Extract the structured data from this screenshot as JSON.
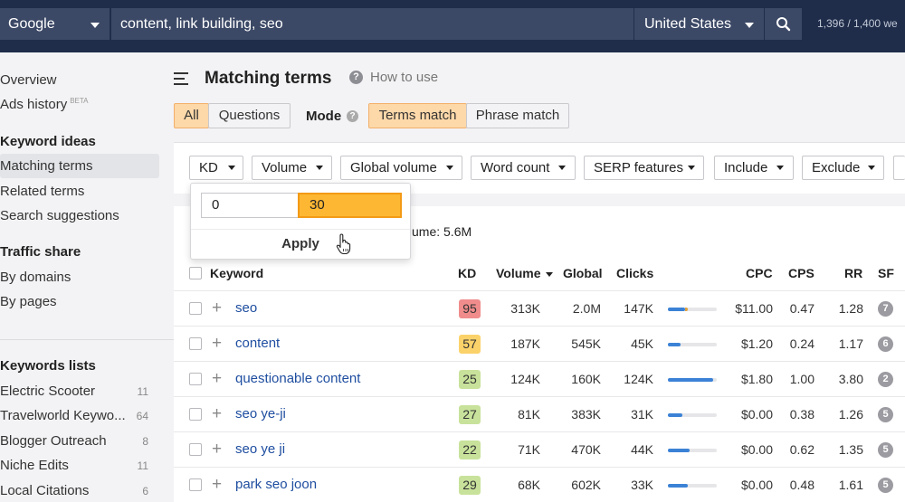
{
  "topbar": {
    "engine": "Google",
    "query": "content, link building, seo",
    "country": "United States",
    "quota": "1,396 / 1,400 we"
  },
  "sidebar": {
    "nav": [
      {
        "label": "Overview"
      },
      {
        "label": "Ads history",
        "badge": "BETA"
      }
    ],
    "keyword_ideas": {
      "heading": "Keyword ideas",
      "items": [
        "Matching terms",
        "Related terms",
        "Search suggestions"
      ]
    },
    "traffic_share": {
      "heading": "Traffic share",
      "items": [
        "By domains",
        "By pages"
      ]
    },
    "keyword_lists": {
      "heading": "Keywords lists",
      "items": [
        {
          "label": "Electric Scooter",
          "count": "11"
        },
        {
          "label": "Travelworld Keywo...",
          "count": "64"
        },
        {
          "label": "Blogger Outreach",
          "count": "8"
        },
        {
          "label": "Niche Edits",
          "count": "11"
        },
        {
          "label": "Local Citations",
          "count": "6"
        }
      ]
    }
  },
  "page": {
    "title": "Matching terms",
    "help_link": "How to use",
    "help_icon": "?",
    "scope_all": "All",
    "scope_questions": "Questions",
    "mode_label": "Mode",
    "mode_terms": "Terms match",
    "mode_phrase": "Phrase match"
  },
  "filters": [
    "KD",
    "Volume",
    "Global volume",
    "Word count",
    "SERP features",
    "Include",
    "Exclude"
  ],
  "kd_popover": {
    "from": "0",
    "to": "30",
    "apply_label": "Apply"
  },
  "summary_text": "ume: 5.6M",
  "table": {
    "headers": {
      "keyword": "Keyword",
      "kd": "KD",
      "volume": "Volume",
      "global": "Global",
      "clicks": "Clicks",
      "cpc": "CPC",
      "cps": "CPS",
      "rr": "RR",
      "sf": "SF"
    },
    "rows": [
      {
        "keyword": "seo",
        "kd": "95",
        "kd_color": "#f08c8c",
        "volume": "313K",
        "global": "2.0M",
        "clicks": "147K",
        "clicks_fill": 0.35,
        "paid_fill": 0.05,
        "cpc": "$11.00",
        "cps": "0.47",
        "rr": "1.28",
        "sf": "7"
      },
      {
        "keyword": "content",
        "kd": "57",
        "kd_color": "#fbd26a",
        "volume": "187K",
        "global": "545K",
        "clicks": "45K",
        "clicks_fill": 0.25,
        "paid_fill": 0.0,
        "cpc": "$1.20",
        "cps": "0.24",
        "rr": "1.17",
        "sf": "6"
      },
      {
        "keyword": "questionable content",
        "kd": "25",
        "kd_color": "#c8e29b",
        "volume": "124K",
        "global": "160K",
        "clicks": "124K",
        "clicks_fill": 0.92,
        "paid_fill": 0.0,
        "cpc": "$1.80",
        "cps": "1.00",
        "rr": "3.80",
        "sf": "2"
      },
      {
        "keyword": "seo ye-ji",
        "kd": "27",
        "kd_color": "#c8e29b",
        "volume": "81K",
        "global": "383K",
        "clicks": "31K",
        "clicks_fill": 0.3,
        "paid_fill": 0.0,
        "cpc": "$0.00",
        "cps": "0.38",
        "rr": "1.26",
        "sf": "5"
      },
      {
        "keyword": "seo ye ji",
        "kd": "22",
        "kd_color": "#c8e29b",
        "volume": "71K",
        "global": "470K",
        "clicks": "44K",
        "clicks_fill": 0.45,
        "paid_fill": 0.0,
        "cpc": "$0.00",
        "cps": "0.62",
        "rr": "1.35",
        "sf": "5"
      },
      {
        "keyword": "park seo joon",
        "kd": "29",
        "kd_color": "#c8e29b",
        "volume": "68K",
        "global": "602K",
        "clicks": "33K",
        "clicks_fill": 0.4,
        "paid_fill": 0.0,
        "cpc": "$0.00",
        "cps": "0.48",
        "rr": "1.61",
        "sf": "5"
      }
    ]
  },
  "icons": {
    "menu": "hamburger-icon",
    "search": "magnifier-icon",
    "cursor": "pointer-hand-icon",
    "add": "plus-icon"
  },
  "colors": {
    "topbar": "#1f2d4b",
    "active_segment": "#fdd8a9",
    "highlight_input": "#fdb733",
    "link": "#1f4ea0",
    "bar": "#3b82d6"
  }
}
